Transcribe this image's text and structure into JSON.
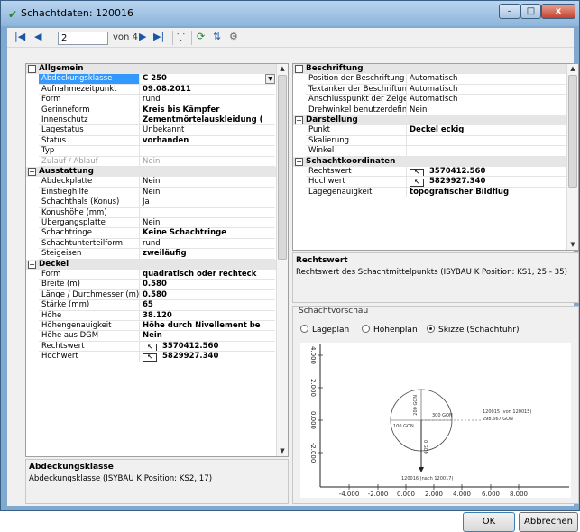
{
  "window": {
    "title": "Schachtdaten: 120016",
    "min": "–",
    "max": "□",
    "close": "x"
  },
  "toolbar": {
    "current_record": "2",
    "of_label": "von 4"
  },
  "left_grid": {
    "sections": [
      {
        "name": "Allgemein",
        "rows": [
          {
            "k": "Abdeckungsklasse",
            "v": "C 250",
            "bold": true,
            "selected": true,
            "dropdown": true
          },
          {
            "k": "Aufnahmezeitpunkt",
            "v": "09.08.2011",
            "bold": true
          },
          {
            "k": "Form",
            "v": "rund"
          },
          {
            "k": "Gerinneform",
            "v": "Kreis bis Kämpfer",
            "bold": true
          },
          {
            "k": "Innenschutz",
            "v": "Zementmörtelauskleidung (",
            "bold": true
          },
          {
            "k": "Lagestatus",
            "v": "Unbekannt"
          },
          {
            "k": "Status",
            "v": "vorhanden",
            "bold": true
          },
          {
            "k": "Typ",
            "v": ""
          },
          {
            "k": "Zulauf / Ablauf",
            "v": "Nein",
            "gray": true
          }
        ]
      },
      {
        "name": "Ausstattung",
        "rows": [
          {
            "k": "Abdeckplatte",
            "v": "Nein"
          },
          {
            "k": "Einstieghilfe",
            "v": "Nein"
          },
          {
            "k": "Schachthals (Konus)",
            "v": "Ja"
          },
          {
            "k": "Konushöhe (mm)",
            "v": ""
          },
          {
            "k": "Übergangsplatte",
            "v": "Nein"
          },
          {
            "k": "Schachtringe",
            "v": "Keine Schachtringe",
            "bold": true
          },
          {
            "k": "Schachtunterteilform",
            "v": "rund"
          },
          {
            "k": "Steigeisen",
            "v": "zweiläufig",
            "bold": true
          }
        ]
      },
      {
        "name": "Deckel",
        "rows": [
          {
            "k": "Form",
            "v": "quadratisch oder rechteck",
            "bold": true
          },
          {
            "k": "Breite (m)",
            "v": "0.580",
            "bold": true
          },
          {
            "k": "Länge / Durchmesser (m)",
            "v": "0.580",
            "bold": true
          },
          {
            "k": "Stärke (mm)",
            "v": "65",
            "bold": true
          },
          {
            "k": "Höhe",
            "v": "38.120",
            "bold": true
          },
          {
            "k": "Höhengenauigkeit",
            "v": "Höhe durch Nivellement be",
            "bold": true
          },
          {
            "k": "Höhe aus DGM",
            "v": "Nein",
            "bold": true
          },
          {
            "k": "Rechtswert",
            "v": "3570412.560",
            "bold": true,
            "coord": true
          },
          {
            "k": "Hochwert",
            "v": "5829927.340",
            "bold": true,
            "coord": true
          }
        ]
      }
    ]
  },
  "right_grid": {
    "sections": [
      {
        "name": "Beschriftung",
        "rows": [
          {
            "k": "Position der Beschriftung",
            "v": "Automatisch"
          },
          {
            "k": "Textanker der Beschriftung",
            "v": "Automatisch"
          },
          {
            "k": "Anschlusspunkt der Zeigelinie",
            "v": "Automatisch"
          },
          {
            "k": "Drehwinkel benutzerdefiniert",
            "v": "Nein"
          }
        ]
      },
      {
        "name": "Darstellung",
        "rows": [
          {
            "k": "Punkt",
            "v": "Deckel eckig",
            "bold": true
          },
          {
            "k": "Skalierung",
            "v": ""
          },
          {
            "k": "Winkel",
            "v": ""
          }
        ]
      },
      {
        "name": "Schachtkoordinaten",
        "rows": [
          {
            "k": "Rechtswert",
            "v": "3570412.560",
            "bold": true,
            "coord": true
          },
          {
            "k": "Hochwert",
            "v": "5829927.340",
            "bold": true,
            "coord": true
          },
          {
            "k": "Lagegenauigkeit",
            "v": "topografischer Bildflug",
            "bold": true
          }
        ]
      }
    ]
  },
  "desc_left": {
    "title": "Abdeckungsklasse",
    "text": "Abdeckungsklasse (ISYBAU K Position: KS2, 17)"
  },
  "desc_right": {
    "title": "Rechtswert",
    "text": "Rechtswert des Schachtmittelpunkts (ISYBAU K Position: KS1, 25 - 35)"
  },
  "preview": {
    "title": "Schachtvorschau",
    "options": [
      {
        "label": "Lageplan",
        "checked": false
      },
      {
        "label": "Höhenplan",
        "checked": false
      },
      {
        "label": "Skizze (Schachtuhr)",
        "checked": true
      }
    ],
    "plot": {
      "x_ticks": [
        "-4.000",
        "-2.000",
        "0.000",
        "2.000",
        "4.000",
        "6.000",
        "8.000"
      ],
      "y_ticks": [
        "4.000",
        "2.000",
        "0.000",
        "-2.000"
      ],
      "labels": {
        "top": "200 GON",
        "right": "300 GON",
        "left": "100 GON",
        "bottom": "0 GON",
        "out_line1": "120015 (von 120015)",
        "out_line2": "298.667 GON",
        "in_label": "120016 (nach 120017)"
      }
    }
  },
  "buttons": {
    "ok": "OK",
    "cancel": "Abbrechen"
  }
}
